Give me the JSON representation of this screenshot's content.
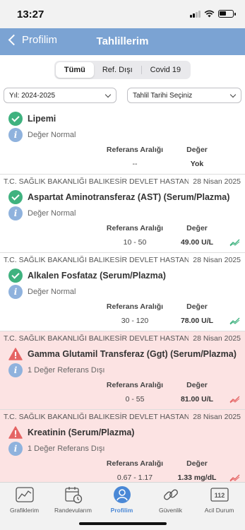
{
  "status_bar": {
    "time": "13:27",
    "battery_level": 0.55
  },
  "nav": {
    "back_label": "Profilim",
    "title": "Tahlillerim"
  },
  "segments": [
    {
      "label": "Tümü",
      "active": true
    },
    {
      "label": "Ref. Dışı",
      "active": false
    },
    {
      "label": "Covid 19",
      "active": false
    }
  ],
  "filters": {
    "year": "Yıl: 2024-2025",
    "date": "Tahlil Tarihi Seçiniz"
  },
  "table_labels": {
    "reference_range": "Referans Aralığı",
    "value": "Değer"
  },
  "results": [
    {
      "hospital": "",
      "date": "",
      "name": "Lipemi",
      "status": "normal",
      "info": "Değer Normal",
      "reference": "--",
      "value": "Yok",
      "trend": false
    },
    {
      "hospital": "T.C. SAĞLIK BAKANLIĞI BALIKESİR DEVLET HASTANESİ",
      "date": "28 Nisan 2025",
      "name": "Aspartat Aminotransferaz (AST) (Serum/Plazma)",
      "status": "normal",
      "info": "Değer Normal",
      "reference": "10 - 50",
      "value": "49.00 U/L",
      "trend": true
    },
    {
      "hospital": "T.C. SAĞLIK BAKANLIĞI BALIKESİR DEVLET HASTANESİ",
      "date": "28 Nisan 2025",
      "name": "Alkalen Fosfataz (Serum/Plazma)",
      "status": "normal",
      "info": "Değer Normal",
      "reference": "30 - 120",
      "value": "78.00 U/L",
      "trend": true
    },
    {
      "hospital": "T.C. SAĞLIK BAKANLIĞI BALIKESİR DEVLET HASTANESİ",
      "date": "28 Nisan 2025",
      "name": "Gamma Glutamil Transferaz (Ggt) (Serum/Plazma)",
      "status": "alert",
      "info": "1 Değer Referans Dışı",
      "reference": "0 - 55",
      "value": "81.00 U/L",
      "trend": true
    },
    {
      "hospital": "T.C. SAĞLIK BAKANLIĞI BALIKESİR DEVLET HASTANESİ",
      "date": "28 Nisan 2025",
      "name": "Kreatinin (Serum/Plazma)",
      "status": "alert",
      "info": "1 Değer Referans Dışı",
      "reference": "0.67 - 1.17",
      "value": "1.33 mg/dL",
      "trend": true
    }
  ],
  "tabs": [
    {
      "label": "Grafiklerim",
      "icon": "chart-icon",
      "active": false
    },
    {
      "label": "Randevularım",
      "icon": "calendar-clock-icon",
      "active": false
    },
    {
      "label": "Profilim",
      "icon": "profile-icon",
      "active": true
    },
    {
      "label": "Güvenlik",
      "icon": "link-icon",
      "active": false
    },
    {
      "label": "Acil Durum",
      "icon": "emergency-112-icon",
      "badge": "112",
      "active": false
    }
  ],
  "colors": {
    "nav_bar": "#7ba3d3",
    "normal_green": "#3fb27f",
    "alert_red": "#e56464",
    "alert_bg": "#fce3e3",
    "info_blue": "#8fb2dd",
    "active_tab": "#4a88d6"
  }
}
